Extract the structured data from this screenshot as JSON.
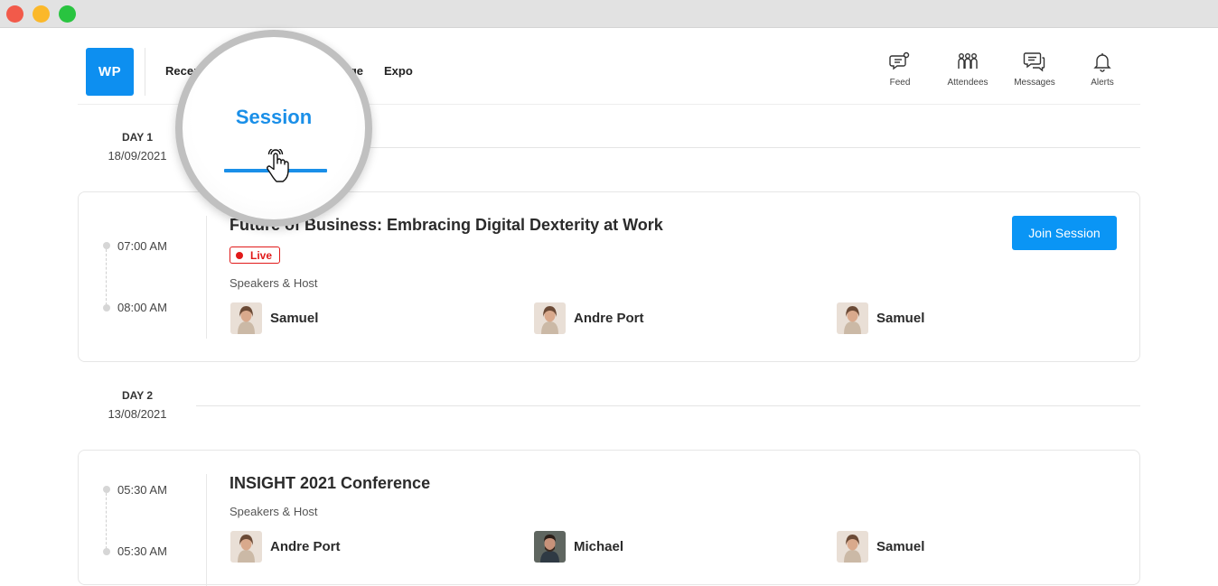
{
  "nav": {
    "logo": "WP",
    "reception": "Reception",
    "lounge": "Lounge",
    "expo": "Expo"
  },
  "top_icons": [
    {
      "label": "Feed",
      "icon": "feed-icon"
    },
    {
      "label": "Attendees",
      "icon": "attendees-icon"
    },
    {
      "label": "Messages",
      "icon": "messages-icon"
    },
    {
      "label": "Alerts",
      "icon": "bell-icon"
    }
  ],
  "magnifier": {
    "label": "Session",
    "icon": "pointer-hand-icon"
  },
  "days": [
    {
      "title": "DAY 1",
      "date": "18/09/2021",
      "session": {
        "start": "07:00 AM",
        "end": "08:00 AM",
        "title": "Future of Business: Embracing Digital Dexterity at Work",
        "status": "Live",
        "speakers_label": "Speakers & Host",
        "join_label": "Join Session",
        "speakers": [
          "Samuel",
          "Andre Port",
          "Samuel"
        ]
      }
    },
    {
      "title": "DAY 2",
      "date": "13/08/2021",
      "session": {
        "start": "05:30 AM",
        "end": "05:30 AM",
        "title": "INSIGHT 2021 Conference",
        "speakers_label": "Speakers & Host",
        "speakers": [
          "Andre Port",
          "Michael",
          "Samuel"
        ]
      }
    }
  ],
  "colors": {
    "accent": "#0a95f5",
    "live": "#e11a1a"
  }
}
